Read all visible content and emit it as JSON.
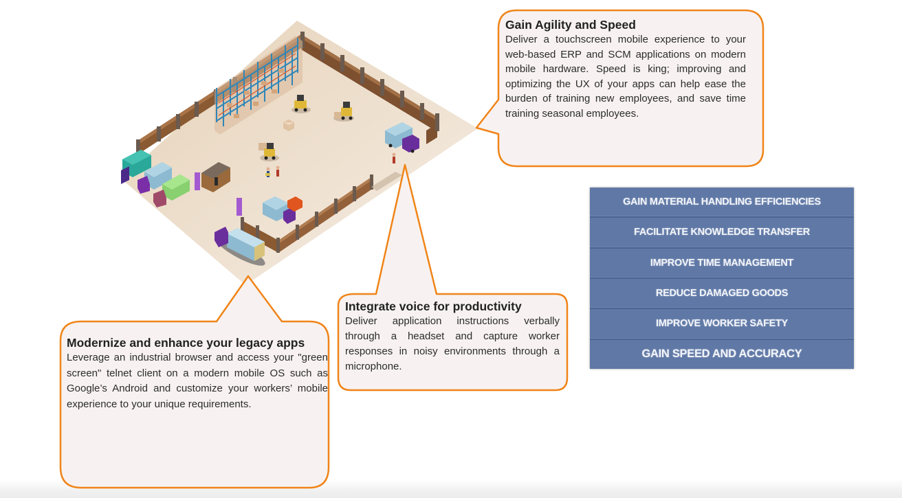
{
  "illustration": {
    "subject": "isometric warehouse floor with storage racks, forklifts, trucks, workers and perimeter wall",
    "colors": {
      "floor": "#ead9c3",
      "wall": "#8a5a32",
      "rack": "#2f86b8",
      "truck_cabin": "#6a2e9c",
      "bubble_border": "#f08418",
      "bubble_fill": "#f7f2f1"
    }
  },
  "callouts": {
    "agility": {
      "title": "Gain Agility and Speed",
      "body": "Deliver a touchscreen mobile experience to your web-based ERP and SCM applications on modern mobile hardware. Speed is king; improving and optimizing the UX of your apps can help ease the burden of training new employees, and save time training seasonal employees."
    },
    "voice": {
      "title": "Integrate voice for productivity",
      "body": "Deliver application instructions verbally through a headset and capture worker responses in noisy environments through a microphone."
    },
    "legacy": {
      "title": "Modernize and enhance your legacy apps",
      "body": "Leverage an industrial browser and access your \"green screen\" telnet client on a modern mobile OS such as Google’s Android and customize your workers’ mobile experience to your unique requirements."
    }
  },
  "benefits": {
    "panel_color": "#5f78a6",
    "items": [
      "GAIN MATERIAL HANDLING EFFICIENCIES",
      "FACILITATE KNOWLEDGE TRANSFER",
      "IMPROVE TIME MANAGEMENT",
      "REDUCE DAMAGED GOODS",
      "IMPROVE WORKER SAFETY",
      "GAIN SPEED AND ACCURACY"
    ]
  }
}
